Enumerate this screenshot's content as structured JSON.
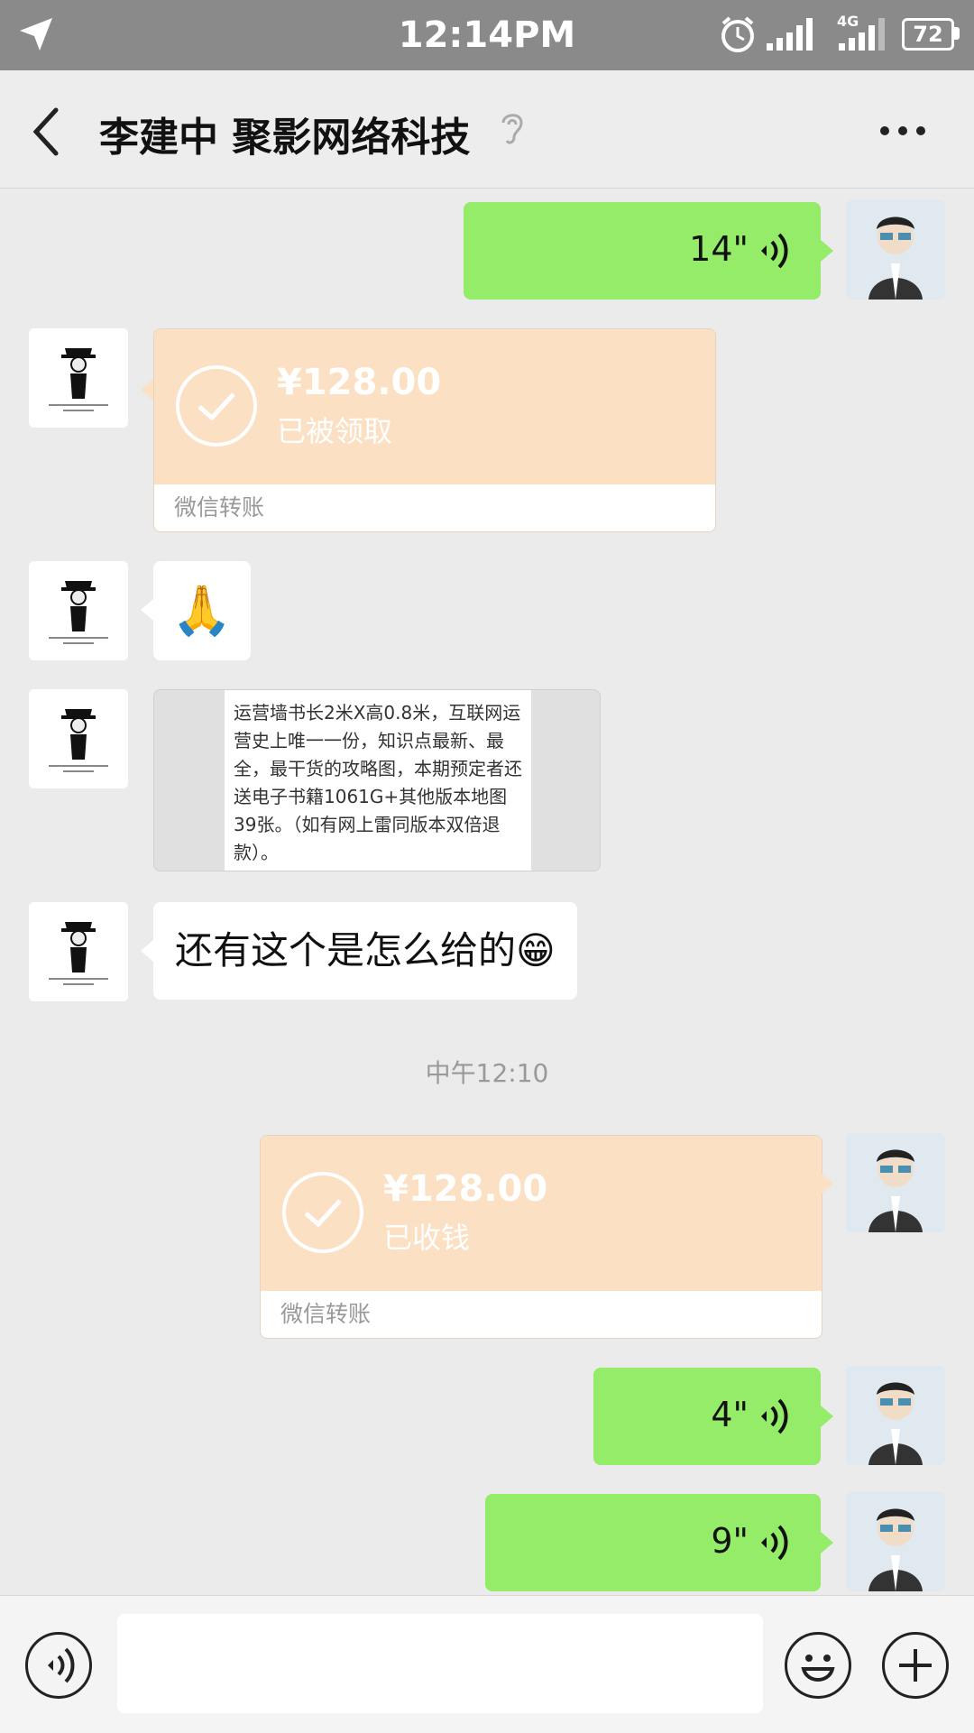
{
  "status_bar": {
    "time": "12:14PM",
    "battery": "72",
    "network": "4G"
  },
  "header": {
    "title": "李建中 聚影网络科技"
  },
  "messages": [
    {
      "type": "voice",
      "sender": "self",
      "duration": "14\""
    },
    {
      "type": "transfer",
      "sender": "other",
      "amount": "¥128.00",
      "status": "已被领取",
      "footer": "微信转账"
    },
    {
      "type": "emoji",
      "sender": "other",
      "emoji": "🙏"
    },
    {
      "type": "image",
      "sender": "other",
      "text": "运营墙书长2米X高0.8米，互联网运营史上唯一一份，知识点最新、最全，最干货的攻略图，本期预定者还送电子书籍1061G+其他版本地图39张。（如有网上雷同版本双倍退款）。"
    },
    {
      "type": "text",
      "sender": "other",
      "text": "还有这个是怎么给的😁"
    },
    {
      "type": "timestamp",
      "text": "中午12:10"
    },
    {
      "type": "transfer",
      "sender": "self",
      "amount": "¥128.00",
      "status": "已收钱",
      "footer": "微信转账"
    },
    {
      "type": "voice",
      "sender": "self",
      "duration": "4\""
    },
    {
      "type": "voice",
      "sender": "self",
      "duration": "9\""
    }
  ],
  "icons": {
    "nav": "navigation-arrow-icon",
    "alarm": "alarm-clock-icon",
    "back": "back-chevron-icon",
    "ear": "ear-icon",
    "more": "more-dots-icon",
    "voice_input": "voice-input-icon",
    "emoji": "emoji-icon",
    "plus": "plus-icon"
  },
  "colors": {
    "status_bar": "#8a8a8a",
    "self_bubble": "#95ec69",
    "transfer": "#fbe0c3",
    "background": "#ebebeb"
  }
}
